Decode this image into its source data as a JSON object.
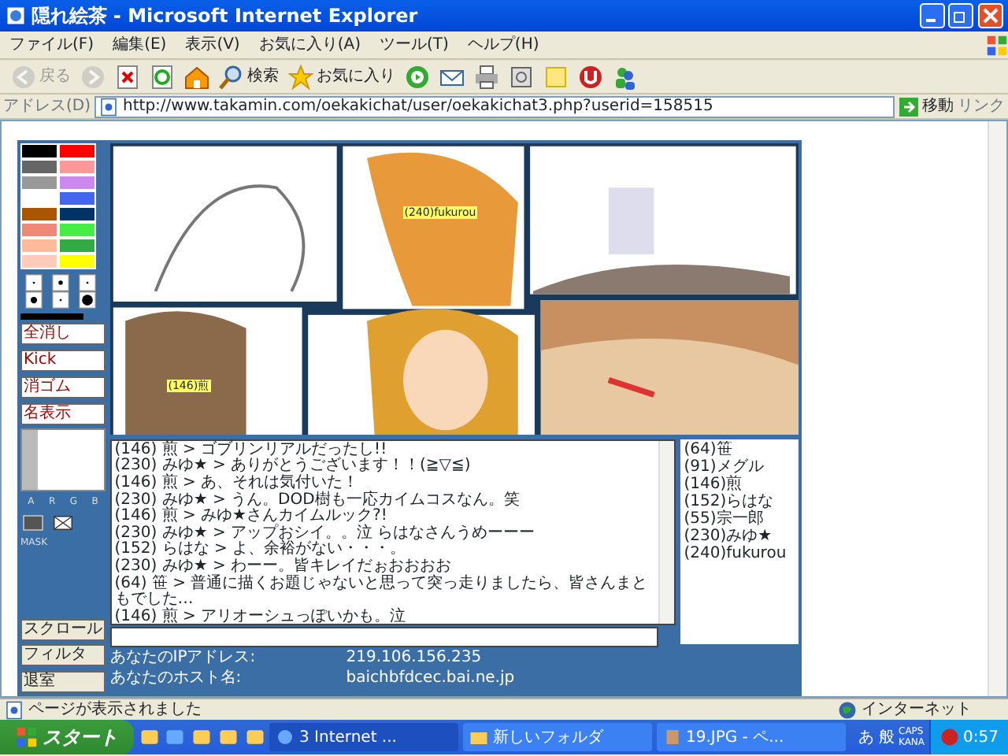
{
  "window": {
    "title": "隠れ絵茶 - Microsoft Internet Explorer"
  },
  "menu": [
    "ファイル(F)",
    "編集(E)",
    "表示(V)",
    "お気に入り(A)",
    "ツール(T)",
    "ヘルプ(H)"
  ],
  "toolbar": [
    {
      "kind": "back",
      "label": "戻る",
      "disabled": true
    },
    {
      "kind": "forward",
      "disabled": true
    },
    {
      "kind": "stop"
    },
    {
      "kind": "refresh"
    },
    {
      "kind": "home"
    },
    {
      "kind": "search",
      "label": "検索"
    },
    {
      "kind": "favorites",
      "label": "お気に入り"
    },
    {
      "kind": "media"
    },
    {
      "kind": "mail"
    },
    {
      "kind": "print"
    },
    {
      "kind": "window"
    },
    {
      "kind": "note"
    },
    {
      "kind": "stopsign"
    },
    {
      "kind": "messenger"
    }
  ],
  "address": {
    "label": "アドレス(D)",
    "url": "http://www.takamin.com/oekakichat/user/oekakichat3.php?userid=158515",
    "go": "移動",
    "links": "リンク"
  },
  "oekaki": {
    "palette": [
      {
        "color": "#000000"
      },
      {
        "color": "#ff0000"
      },
      {
        "color": "#666666"
      },
      {
        "color": "#ff9999"
      },
      {
        "color": "#999999"
      },
      {
        "color": "#cc88ee"
      },
      {
        "color": "#ffffff"
      },
      {
        "color": "#4466ee"
      },
      {
        "color": "#aa5500"
      },
      {
        "color": "#003366"
      },
      {
        "color": "#ee8877"
      },
      {
        "color": "#44ee44"
      },
      {
        "color": "#ffbb99"
      },
      {
        "color": "#33aa44"
      },
      {
        "color": "#ffccbb"
      },
      {
        "color": "#ffff00"
      }
    ],
    "tools": [
      "全消し",
      "Kick",
      "消ゴム",
      "名表示"
    ],
    "alpha_slider": {
      "level": 0.2
    },
    "channels": [
      "A",
      "R",
      "G",
      "B"
    ],
    "mask": "MASK",
    "scroll_button": "スクロール",
    "filter_button": "フィルタ",
    "exit_button": "退室",
    "canvas": {
      "kind": "picture",
      "tags": [
        "(240)fukurou",
        "(146)煎"
      ]
    },
    "chat": [
      "(146) 煎 > ゴブリンリアルだったし!!",
      "(230) みゆ★ > ありがとうございます！！(≧▽≦)",
      "(146) 煎 > あ、それは気付いた！",
      "(230) みゆ★ > うん。DOD樹も一応カイムコスなん。笑",
      "(146) 煎 > みゆ★さんカイムルック?!",
      "(230) みゆ★ > アップおシイ。。泣 らはなさんうめーーー",
      "(152) らはな > よ、余裕がない・・・。",
      "(230) みゆ★ > わーー。皆キレイだぉおおおお",
      "(64) 笹 > 普通に描くお題じゃないと思って突っ走りましたら、皆さんまともでした…",
      "(146) 煎 > アリオーシュっぽいかも。泣"
    ],
    "users": [
      "(64)笹",
      "(91)メグル",
      "(146)煎",
      "(152)らはな",
      "(55)宗一郎",
      "(230)みゆ★",
      "(240)fukurou"
    ],
    "info": [
      {
        "label": "あなたのIPアドレス:",
        "value": "219.106.156.235"
      },
      {
        "label": "あなたのホスト名:",
        "value": "baichbfdcec.bai.ne.jp"
      }
    ]
  },
  "status_bar": {
    "text": "ページが表示されました",
    "zone": "インターネット"
  },
  "taskbar": {
    "start": "スタート",
    "tasks": [
      {
        "kind": "ie",
        "label": "3 Internet ...",
        "selected": true
      },
      {
        "kind": "folder",
        "label": "新しいフォルダ",
        "selected": false
      },
      {
        "kind": "paint",
        "label": "19.JPG - ペ...",
        "selected": false
      }
    ],
    "ime": [
      "あ",
      "般"
    ],
    "locks": [
      "CAPS",
      "KANA"
    ],
    "clock": "0:57"
  }
}
